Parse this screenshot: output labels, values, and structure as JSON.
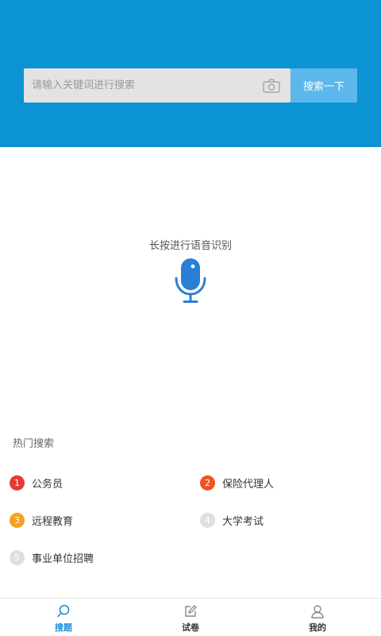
{
  "search": {
    "placeholder": "请输入关键词进行搜索",
    "button_label": "搜索一下"
  },
  "voice": {
    "label": "长按进行语音识别"
  },
  "hot": {
    "title": "热门搜索",
    "items": [
      {
        "rank": "1",
        "label": "公务员",
        "color": "#e53935"
      },
      {
        "rank": "2",
        "label": "保险代理人",
        "color": "#ef5322"
      },
      {
        "rank": "3",
        "label": "远程教育",
        "color": "#f5a020"
      },
      {
        "rank": "4",
        "label": "大学考试",
        "color": "#e2dede"
      },
      {
        "rank": "5",
        "label": "事业单位招聘",
        "color": "#e2dede"
      }
    ]
  },
  "tabs": [
    {
      "label": "搜题",
      "icon": "search-icon",
      "active": true
    },
    {
      "label": "试卷",
      "icon": "edit-icon",
      "active": false
    },
    {
      "label": "我的",
      "icon": "user-icon",
      "active": false
    }
  ],
  "colors": {
    "header": "#0b93d3",
    "accent": "#1a8fd6",
    "mic": "#2a7fd4"
  }
}
